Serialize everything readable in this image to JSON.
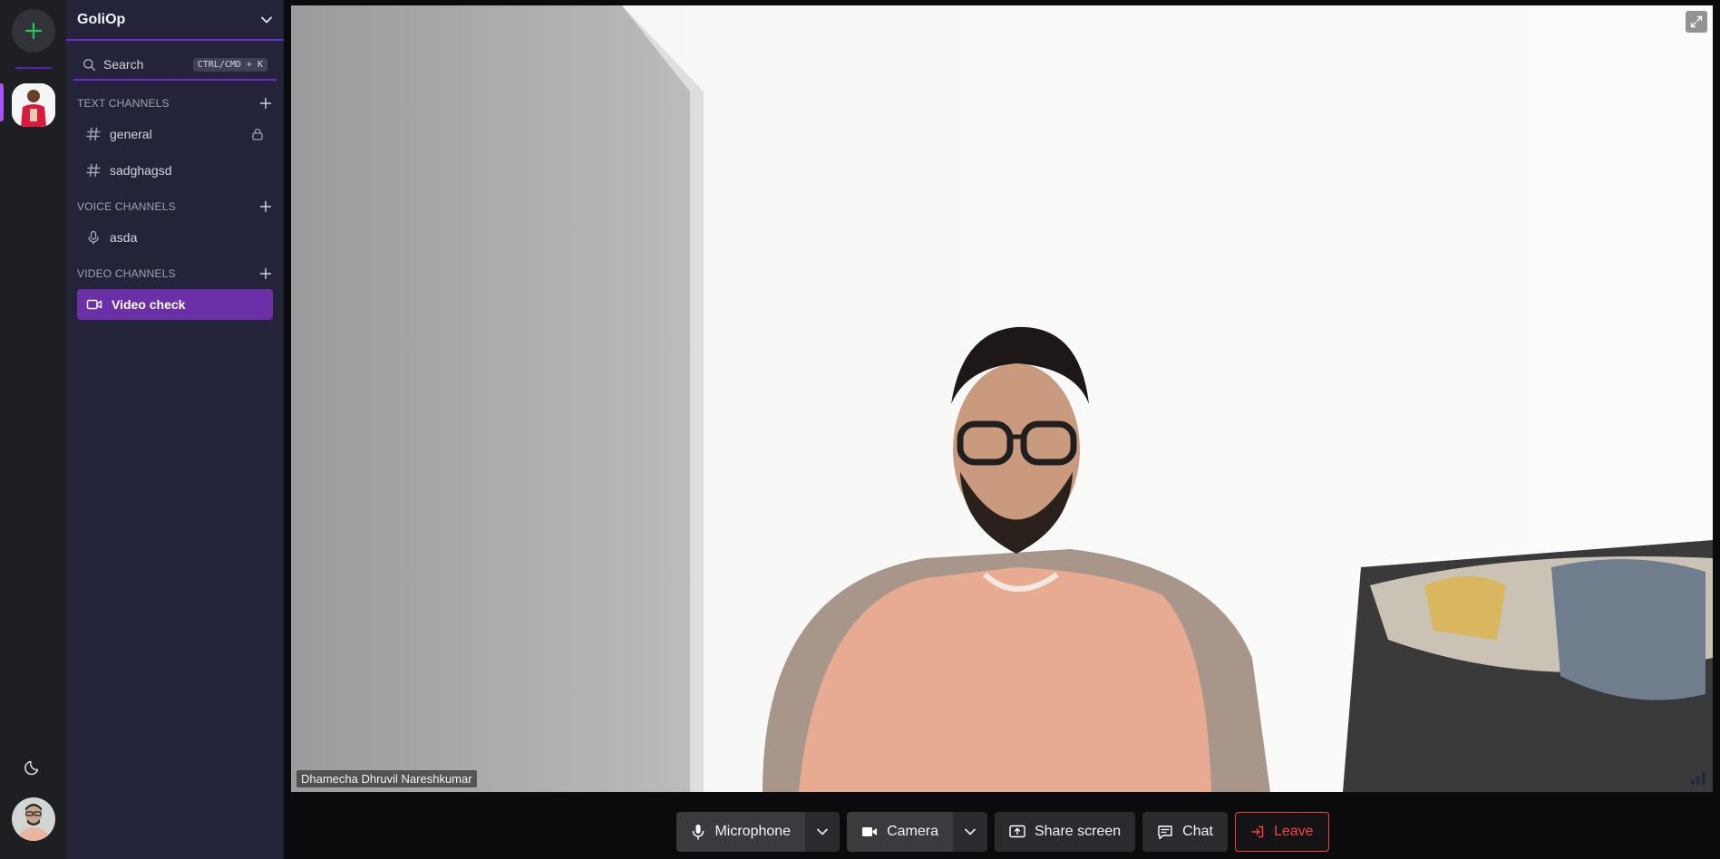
{
  "server": {
    "name": "GoliOp"
  },
  "search": {
    "label": "Search",
    "shortcut": "CTRL/CMD + K"
  },
  "sections": {
    "text": {
      "title": "TEXT CHANNELS"
    },
    "voice": {
      "title": "VOICE CHANNELS"
    },
    "video": {
      "title": "VIDEO CHANNELS"
    }
  },
  "text_channels": [
    {
      "label": "general",
      "locked": true
    },
    {
      "label": "sadghagsd",
      "locked": false
    }
  ],
  "voice_channels": [
    {
      "label": "asda"
    }
  ],
  "video_channels": [
    {
      "label": "Video check",
      "active": true
    }
  ],
  "participant": {
    "name": "Dhamecha Dhruvil Nareshkumar"
  },
  "controls": {
    "microphone": "Microphone",
    "camera": "Camera",
    "share_screen": "Share screen",
    "chat": "Chat",
    "leave": "Leave"
  },
  "colors": {
    "accent": "#6d28d9",
    "active_channel": "#6b2fa8",
    "add_button_icon": "#22c55e",
    "leave": "#ef4444"
  }
}
